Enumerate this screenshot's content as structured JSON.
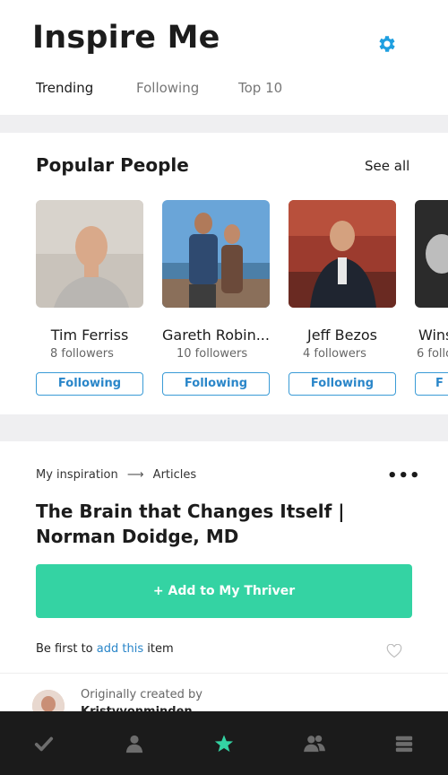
{
  "app": {
    "title": "Inspire Me"
  },
  "tabs": [
    {
      "label": "Trending",
      "active": true
    },
    {
      "label": "Following",
      "active": false
    },
    {
      "label": "Top 10",
      "active": false
    }
  ],
  "popular": {
    "title": "Popular People",
    "see_all": "See all",
    "people": [
      {
        "name": "Tim Ferriss",
        "followers": "8 followers",
        "button": "Following"
      },
      {
        "name": "Gareth Robin...",
        "followers": "10 followers",
        "button": "Following"
      },
      {
        "name": "Jeff Bezos",
        "followers": "4 followers",
        "button": "Following"
      },
      {
        "name": "Wins",
        "followers": "6 follo",
        "button": "F"
      }
    ]
  },
  "article": {
    "breadcrumb_root": "My inspiration",
    "breadcrumb_arrow": "⟶",
    "breadcrumb_leaf": "Articles",
    "menu": "•••",
    "title": " The Brain that Changes Itself |  Norman Doidge, MD",
    "add_button": "+ Add to My Thriver",
    "be_first_prefix": "Be first to ",
    "be_first_link": "add this",
    "be_first_suffix": " item",
    "created_label": "Originally created by",
    "creator": "Kristyvonminden"
  },
  "colors": {
    "accent": "#34d3a3",
    "link": "#2a86c9",
    "gear": "#1e9fe0",
    "nav_bg": "#1b1b1b",
    "nav_active": "#34d3a3",
    "nav_inactive": "#6d6d6d"
  },
  "icons": {
    "settings": "gear-icon",
    "like": "heart-icon",
    "nav": [
      "check-icon",
      "person-icon",
      "star-icon",
      "group-icon",
      "stack-icon"
    ]
  }
}
